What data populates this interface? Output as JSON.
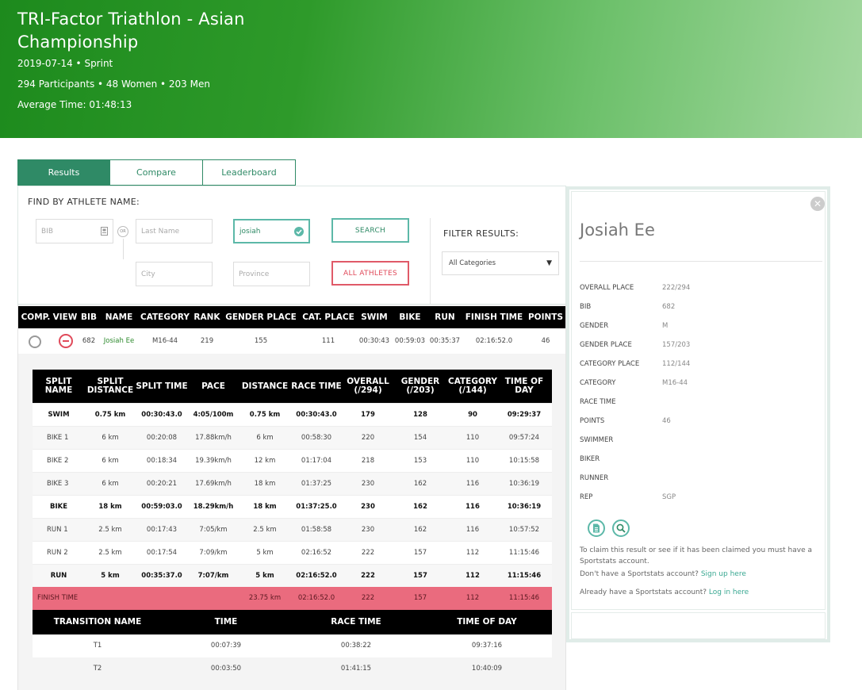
{
  "event": {
    "title": "TRI-Factor Triathlon - Asian Championship",
    "date_type": "2019-07-14 • Sprint",
    "participants": "294 Participants • 48 Women • 203 Men",
    "average": "Average Time: 01:48:13"
  },
  "tabs": [
    "Results",
    "Compare",
    "Leaderboard"
  ],
  "search": {
    "label": "FIND BY ATHLETE NAME:",
    "bib_placeholder": "BIB",
    "or": "OR",
    "last_name_placeholder": "Last Name",
    "first_name_value": "josiah",
    "city_placeholder": "City",
    "province_placeholder": "Province",
    "search_btn": "SEARCH",
    "all_btn": "ALL ATHLETES",
    "filter_label": "FILTER RESULTS:",
    "filter_value": "All Categories"
  },
  "results": {
    "headers": [
      "COMP.",
      "VIEW",
      "BIB",
      "NAME",
      "CATEGORY",
      "RANK",
      "GENDER PLACE",
      "CAT. PLACE",
      "SWIM",
      "BIKE",
      "RUN",
      "FINISH TIME",
      "POINTS"
    ],
    "row": {
      "bib": "682",
      "name": "Josiah Ee",
      "category": "M16-44",
      "rank": "219",
      "gender_place": "155",
      "cat_place": "111",
      "swim": "00:30:43",
      "bike": "00:59:03",
      "run": "00:35:37",
      "finish": "02:16:52.0",
      "points": "46"
    }
  },
  "splits": {
    "headers": [
      "SPLIT NAME",
      "SPLIT DISTANCE",
      "SPLIT TIME",
      "PACE",
      "DISTANCE",
      "RACE TIME",
      "OVERALL (/294)",
      "GENDER (/203)",
      "CATEGORY (/144)",
      "TIME OF DAY"
    ],
    "rows": [
      {
        "name": "SWIM",
        "dist": "0.75 km",
        "time": "00:30:43.0",
        "pace": "4:05/100m",
        "distance": "0.75 km",
        "race": "00:30:43.0",
        "overall": "179",
        "gender": "128",
        "category": "90",
        "tod": "09:29:37",
        "bold": true
      },
      {
        "name": "BIKE 1",
        "dist": "6 km",
        "time": "00:20:08",
        "pace": "17.88km/h",
        "distance": "6 km",
        "race": "00:58:30",
        "overall": "220",
        "gender": "154",
        "category": "110",
        "tod": "09:57:24",
        "bold": false
      },
      {
        "name": "BIKE 2",
        "dist": "6 km",
        "time": "00:18:34",
        "pace": "19.39km/h",
        "distance": "12 km",
        "race": "01:17:04",
        "overall": "218",
        "gender": "153",
        "category": "110",
        "tod": "10:15:58",
        "bold": false
      },
      {
        "name": "BIKE 3",
        "dist": "6 km",
        "time": "00:20:21",
        "pace": "17.69km/h",
        "distance": "18 km",
        "race": "01:37:25",
        "overall": "230",
        "gender": "162",
        "category": "116",
        "tod": "10:36:19",
        "bold": false
      },
      {
        "name": "BIKE",
        "dist": "18 km",
        "time": "00:59:03.0",
        "pace": "18.29km/h",
        "distance": "18 km",
        "race": "01:37:25.0",
        "overall": "230",
        "gender": "162",
        "category": "116",
        "tod": "10:36:19",
        "bold": true
      },
      {
        "name": "RUN 1",
        "dist": "2.5 km",
        "time": "00:17:43",
        "pace": "7:05/km",
        "distance": "2.5 km",
        "race": "01:58:58",
        "overall": "230",
        "gender": "162",
        "category": "116",
        "tod": "10:57:52",
        "bold": false
      },
      {
        "name": "RUN 2",
        "dist": "2.5 km",
        "time": "00:17:54",
        "pace": "7:09/km",
        "distance": "5 km",
        "race": "02:16:52",
        "overall": "222",
        "gender": "157",
        "category": "112",
        "tod": "11:15:46",
        "bold": false
      },
      {
        "name": "RUN",
        "dist": "5 km",
        "time": "00:35:37.0",
        "pace": "7:07/km",
        "distance": "5 km",
        "race": "02:16:52.0",
        "overall": "222",
        "gender": "157",
        "category": "112",
        "tod": "11:15:46",
        "bold": true
      }
    ],
    "finish": {
      "name": "FINISH TIME",
      "distance": "23.75 km",
      "race": "02:16:52.0",
      "overall": "222",
      "gender": "157",
      "category": "112",
      "tod": "11:15:46"
    }
  },
  "transitions": {
    "headers": [
      "TRANSITION NAME",
      "TIME",
      "RACE TIME",
      "TIME OF DAY"
    ],
    "rows": [
      {
        "name": "T1",
        "time": "00:07:39",
        "race": "00:38:22",
        "tod": "09:37:16"
      },
      {
        "name": "T2",
        "time": "00:03:50",
        "race": "01:41:15",
        "tod": "10:40:09"
      }
    ]
  },
  "profile": {
    "name": "Josiah Ee",
    "close_icon": "close-icon",
    "rows": [
      {
        "k": "OVERALL PLACE",
        "v": "222/294"
      },
      {
        "k": "BIB",
        "v": "682"
      },
      {
        "k": "GENDER",
        "v": "M"
      },
      {
        "k": "GENDER PLACE",
        "v": "157/203"
      },
      {
        "k": "CATEGORY PLACE",
        "v": "112/144"
      },
      {
        "k": "CATEGORY",
        "v": "M16-44"
      },
      {
        "k": "RACE TIME",
        "v": ""
      },
      {
        "k": "POINTS",
        "v": "46"
      },
      {
        "k": "SWIMMER",
        "v": ""
      },
      {
        "k": "BIKER",
        "v": ""
      },
      {
        "k": "RUNNER",
        "v": ""
      },
      {
        "k": "REP",
        "v": "SGP"
      }
    ],
    "claim_text": "To claim this result or see if it has been claimed you must have a Sportstats account.",
    "no_account": "Don't have a Sportstats account?",
    "signup": "Sign up here",
    "already": "Already have a Sportstats account?",
    "login": "Log in here"
  },
  "colors": {
    "brand": "#2f8a66",
    "accent": "#5cb8a8",
    "danger": "#e04a5a",
    "finish_bg": "#ea6b7e"
  }
}
